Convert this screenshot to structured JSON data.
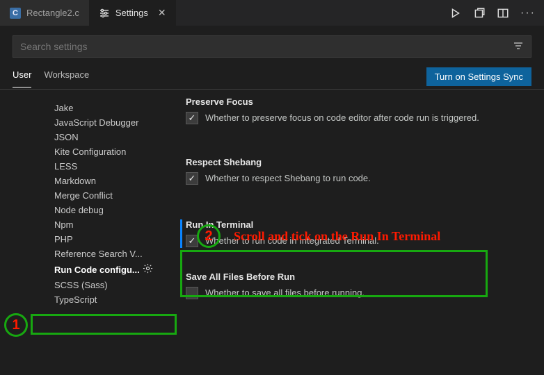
{
  "tabs": {
    "inactive": "Rectangle2.c",
    "active": "Settings"
  },
  "search": {
    "placeholder": "Search settings"
  },
  "scope": {
    "tabs": [
      "User",
      "Workspace"
    ],
    "active": "User",
    "sync_button": "Turn on Settings Sync"
  },
  "toc": {
    "items": [
      "Jake",
      "JavaScript Debugger",
      "JSON",
      "Kite Configuration",
      "LESS",
      "Markdown",
      "Merge Conflict",
      "Node debug",
      "Npm",
      "PHP",
      "Reference Search V...",
      "Run Code configu...",
      "SCSS (Sass)",
      "TypeScript"
    ],
    "selected_index": 11
  },
  "settings": [
    {
      "title": "Preserve Focus",
      "checked": true,
      "desc": "Whether to preserve focus on code editor after code run is triggered."
    },
    {
      "title": "Respect Shebang",
      "checked": true,
      "desc": "Whether to respect Shebang to run code."
    },
    {
      "title": "Run In Terminal",
      "checked": true,
      "modified": true,
      "desc": "Whether to run code in Integrated Terminal."
    },
    {
      "title": "Save All Files Before Run",
      "checked": false,
      "desc": "Whether to save all files before running."
    }
  ],
  "annotations": {
    "step1": "1",
    "step2": "2",
    "text": "Scroll and tick on the Run In Terminal"
  }
}
